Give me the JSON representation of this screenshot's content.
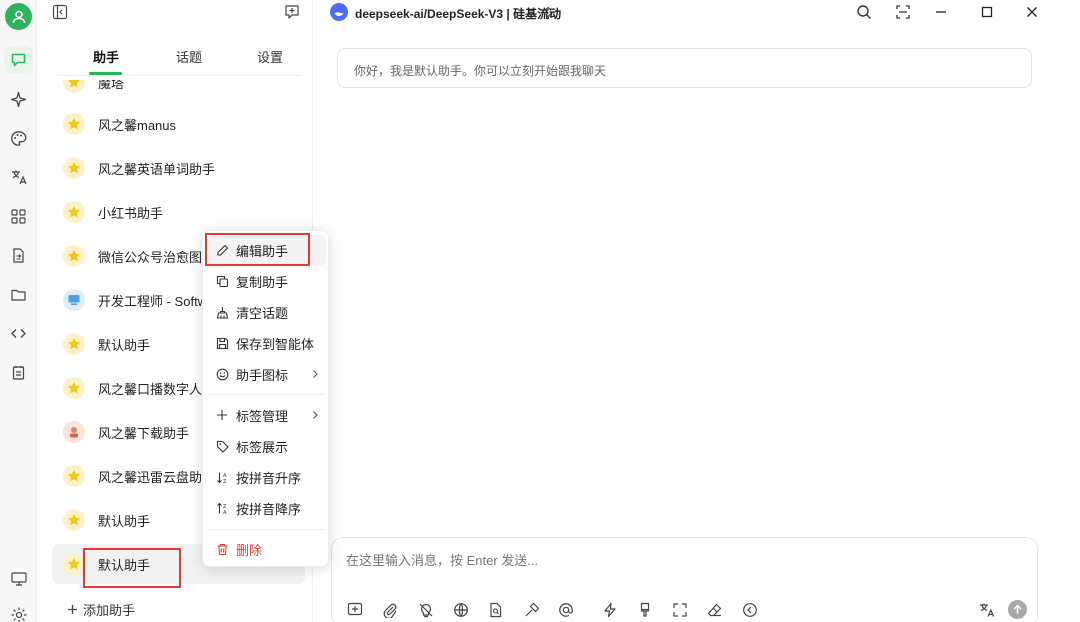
{
  "app": {
    "model_label": "deepseek-ai/DeepSeek-V3 | 硅基流动",
    "accent_color": "#2db35a"
  },
  "sidebar": {
    "tabs": [
      {
        "label": "助手"
      },
      {
        "label": "话题"
      },
      {
        "label": "设置"
      }
    ],
    "items": [
      {
        "label": "魔塔",
        "icon": "star-icon"
      },
      {
        "label": "风之馨manus",
        "icon": "star-icon"
      },
      {
        "label": "风之馨英语单词助手",
        "icon": "star-icon"
      },
      {
        "label": "小红书助手",
        "icon": "star-icon"
      },
      {
        "label": "微信公众号治愈图",
        "icon": "star-icon"
      },
      {
        "label": "开发工程师 - Softw",
        "icon": "computer-icon"
      },
      {
        "label": "默认助手",
        "icon": "star-icon"
      },
      {
        "label": "风之馨口播数字人",
        "icon": "star-icon"
      },
      {
        "label": "风之馨下载助手",
        "icon": "character-icon"
      },
      {
        "label": "风之馨迅雷云盘助",
        "icon": "star-icon"
      },
      {
        "label": "默认助手",
        "icon": "star-icon"
      },
      {
        "label": "默认助手",
        "icon": "star-icon"
      }
    ],
    "add_label": "添加助手"
  },
  "chat": {
    "greeting": "你好，我是默认助手。你可以立刻开始跟我聊天",
    "input_placeholder": "在这里输入消息，按 Enter 发送..."
  },
  "context_menu": {
    "items": [
      {
        "label": "编辑助手",
        "icon": "pencil-icon"
      },
      {
        "label": "复制助手",
        "icon": "copy-icon"
      },
      {
        "label": "清空话题",
        "icon": "broom-icon"
      },
      {
        "label": "保存到智能体",
        "icon": "save-icon"
      },
      {
        "label": "助手图标",
        "icon": "smile-icon"
      },
      {
        "label": "标签管理",
        "icon": "plus-icon"
      },
      {
        "label": "标签展示",
        "icon": "tag-icon"
      },
      {
        "label": "按拼音升序",
        "icon": "sort-asc-icon"
      },
      {
        "label": "按拼音降序",
        "icon": "sort-desc-icon"
      },
      {
        "label": "删除",
        "icon": "trash-icon"
      }
    ]
  }
}
